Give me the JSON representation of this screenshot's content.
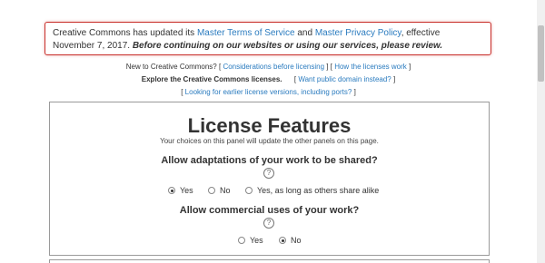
{
  "notice": {
    "text_before": "Creative Commons has updated its ",
    "link_terms": "Master Terms of Service",
    "text_and": " and ",
    "link_privacy": "Master Privacy Policy",
    "text_after": ", effective November 7, 2017. ",
    "emphasis": "Before continuing on our websites or using our services, please review."
  },
  "links": {
    "line1_prefix": "New to Creative Commons? [",
    "considerations": "Considerations before licensing",
    "sep1": "] [",
    "how_works": "How the licenses work",
    "line1_suffix": "]",
    "line2_bold": "Explore the Creative Commons licenses.",
    "line2_open": "[",
    "public_domain": "Want public domain instead?",
    "line2_close": "]",
    "line3_open": "[",
    "earlier_versions": "Looking for earlier license versions, including ports?",
    "line3_close": "]"
  },
  "panel": {
    "title": "License Features",
    "subtitle": "Your choices on this panel will update the other panels on this page.",
    "q1": "Allow adaptations of your work to be shared?",
    "q1_help": "?",
    "q1_options": [
      "Yes",
      "No",
      "Yes, as long as others share alike"
    ],
    "q1_selected": "Yes",
    "q2": "Allow commercial uses of your work?",
    "q2_help": "?",
    "q2_options": [
      "Yes",
      "No"
    ],
    "q2_selected": "No"
  }
}
